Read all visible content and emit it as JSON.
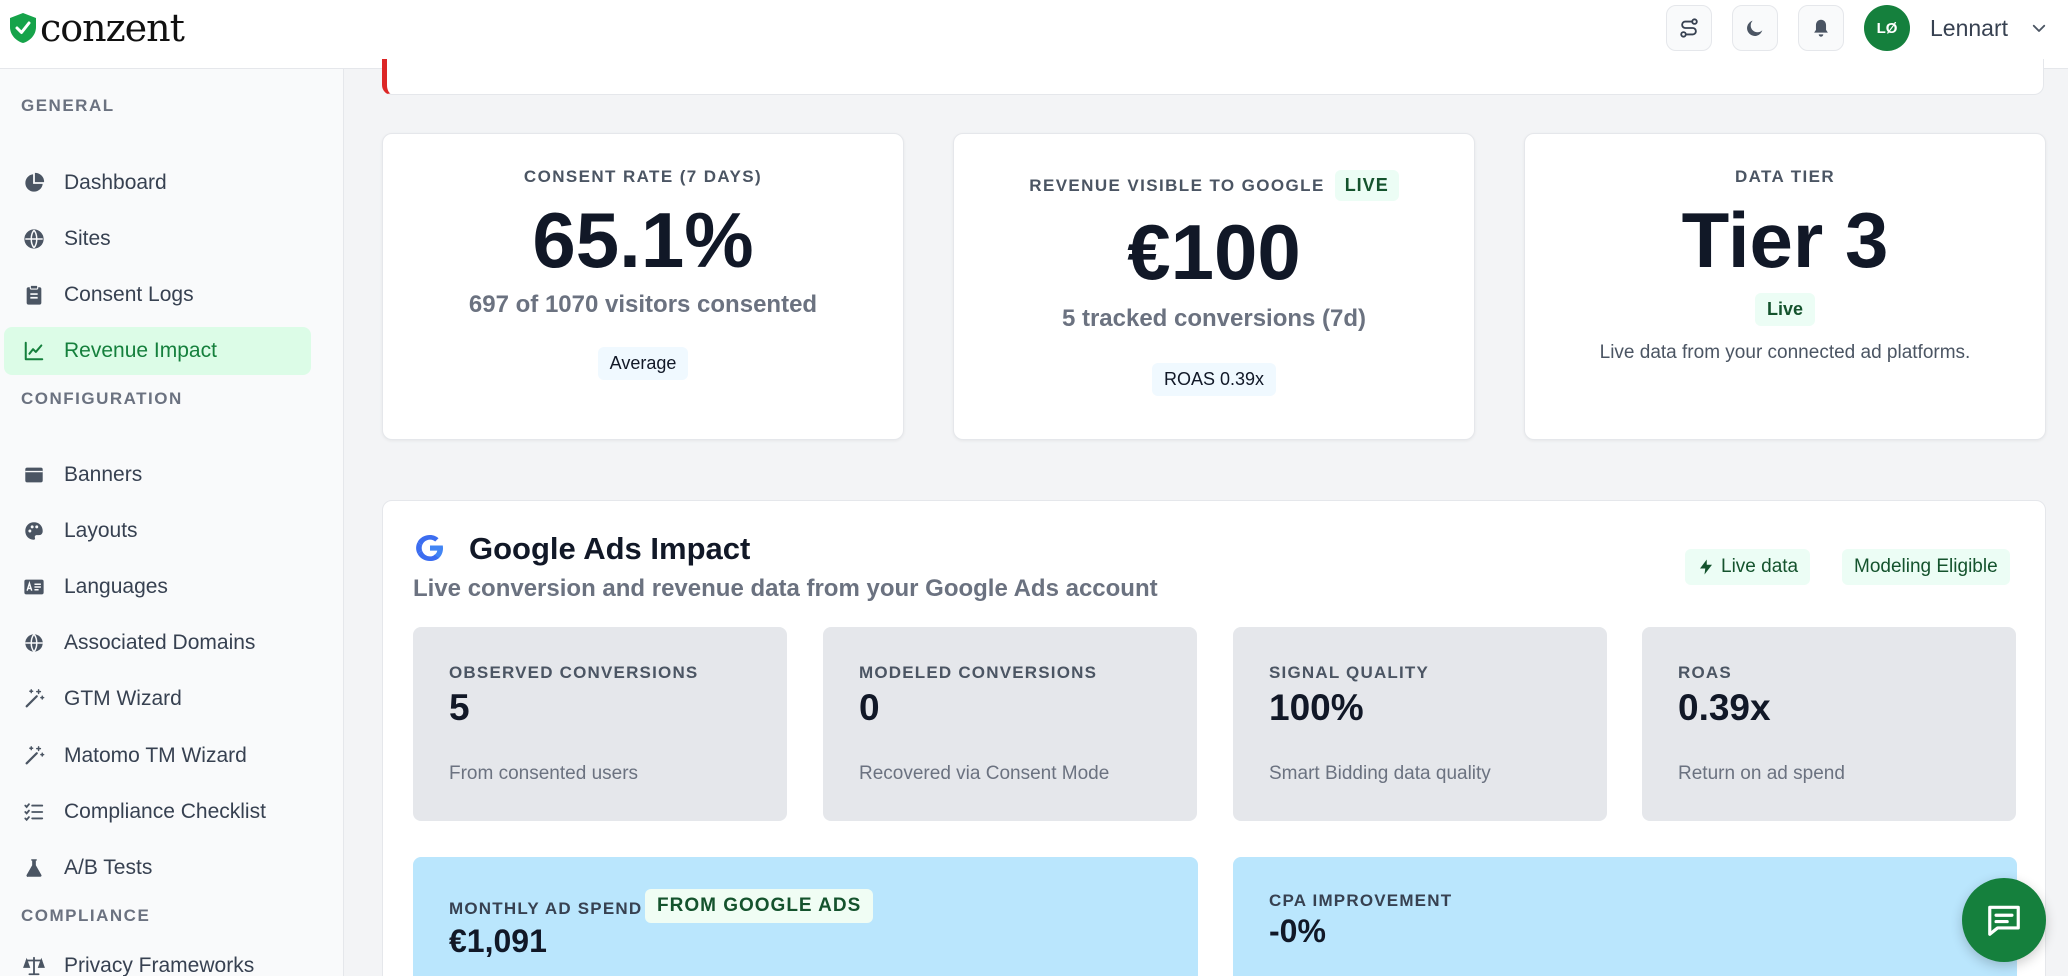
{
  "app": {
    "logo_text": "conzent"
  },
  "header": {
    "user_initials": "LØ",
    "user_name": "Lennart"
  },
  "sidebar": {
    "sections": [
      {
        "title": "GENERAL",
        "items": [
          {
            "label": "Dashboard",
            "icon": "pie-chart-icon",
            "active": false
          },
          {
            "label": "Sites",
            "icon": "globe-icon",
            "active": false
          },
          {
            "label": "Consent Logs",
            "icon": "clipboard-icon",
            "active": false
          },
          {
            "label": "Revenue Impact",
            "icon": "trend-chart-icon",
            "active": true
          }
        ]
      },
      {
        "title": "CONFIGURATION",
        "items": [
          {
            "label": "Banners",
            "icon": "window-icon",
            "active": false
          },
          {
            "label": "Layouts",
            "icon": "palette-icon",
            "active": false
          },
          {
            "label": "Languages",
            "icon": "language-card-icon",
            "active": false
          },
          {
            "label": "Associated Domains",
            "icon": "globe-icon",
            "active": false
          },
          {
            "label": "GTM Wizard",
            "icon": "magic-wand-icon",
            "active": false
          },
          {
            "label": "Matomo TM Wizard",
            "icon": "magic-wand-icon",
            "active": false
          },
          {
            "label": "Compliance Checklist",
            "icon": "checklist-icon",
            "active": false
          },
          {
            "label": "A/B Tests",
            "icon": "flask-icon",
            "active": false
          }
        ]
      },
      {
        "title": "COMPLIANCE",
        "items": [
          {
            "label": "Privacy Frameworks",
            "icon": "scales-icon",
            "active": false
          }
        ]
      }
    ]
  },
  "kpis": {
    "consent": {
      "label": "CONSENT RATE (7 DAYS)",
      "value": "65.1%",
      "sub": "697 of 1070 visitors consented",
      "badge": "Average"
    },
    "revenue": {
      "label": "REVENUE VISIBLE TO GOOGLE",
      "live_tag": "LIVE",
      "value": "€100",
      "sub": "5 tracked conversions (7d)",
      "badge": "ROAS 0.39x"
    },
    "tier": {
      "label": "DATA TIER",
      "value": "Tier 3",
      "badge": "Live",
      "desc": "Live data from your connected ad platforms."
    }
  },
  "google_ads": {
    "title": "Google Ads Impact",
    "subtitle": "Live conversion and revenue data from your Google Ads account",
    "tag_live": "Live data",
    "tag_modeling": "Modeling Eligible",
    "metrics": [
      {
        "label": "OBSERVED CONVERSIONS",
        "value": "5",
        "desc": "From consented users"
      },
      {
        "label": "MODELED CONVERSIONS",
        "value": "0",
        "desc": "Recovered via Consent Mode"
      },
      {
        "label": "SIGNAL QUALITY",
        "value": "100%",
        "desc": "Smart Bidding data quality"
      },
      {
        "label": "ROAS",
        "value": "0.39x",
        "desc": "Return on ad spend"
      }
    ],
    "spend": {
      "label": "MONTHLY AD SPEND",
      "tag": "FROM GOOGLE ADS",
      "value": "€1,091"
    },
    "cpa": {
      "label": "CPA IMPROVEMENT",
      "value": "-0%"
    }
  },
  "colors": {
    "brand_green": "#15803d",
    "active_bg": "#dcfce7",
    "alert_red": "#dc2626",
    "blue_card": "#bae6fd"
  }
}
